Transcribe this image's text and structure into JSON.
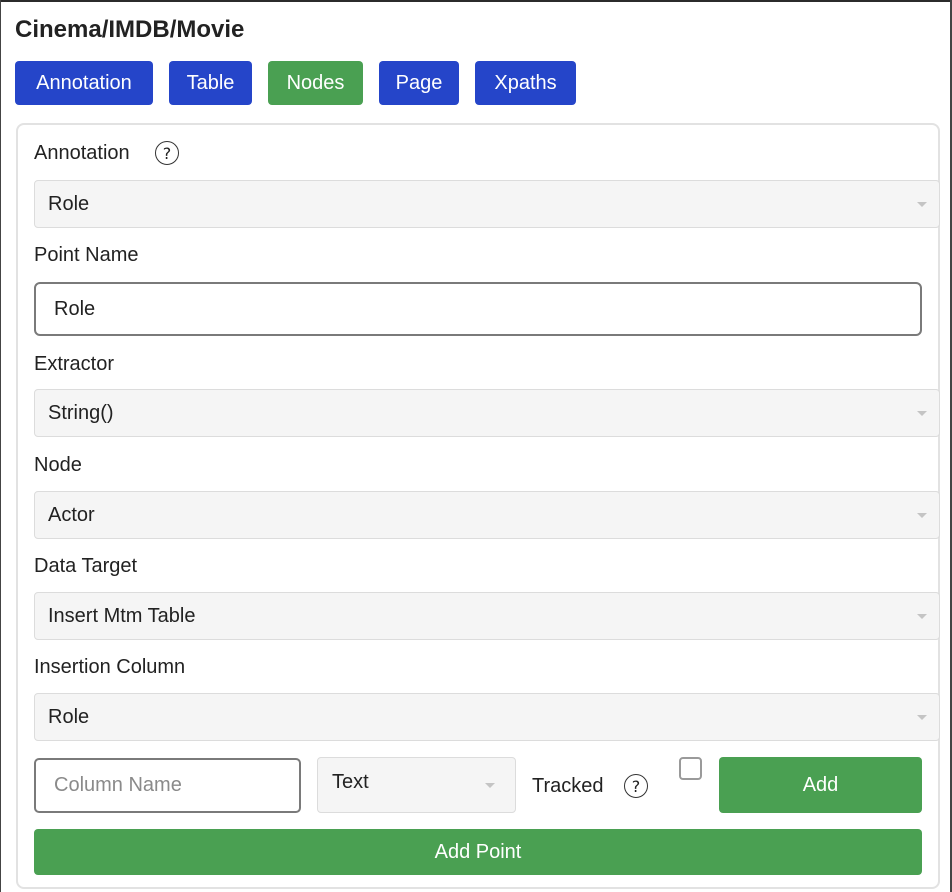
{
  "header": {
    "title": "Cinema/IMDB/Movie"
  },
  "nav": {
    "annotation": "Annotation",
    "table": "Table",
    "nodes": "Nodes",
    "page": "Page",
    "xpaths": "Xpaths"
  },
  "form": {
    "annotation": {
      "label": "Annotation",
      "help": "?",
      "value": "Role"
    },
    "point_name": {
      "label": "Point Name",
      "value": "Role"
    },
    "extractor": {
      "label": "Extractor",
      "value": "String()"
    },
    "node": {
      "label": "Node",
      "value": "Actor"
    },
    "data_target": {
      "label": "Data Target",
      "value": "Insert Mtm Table"
    },
    "insertion_column": {
      "label": "Insertion Column",
      "value": "Role"
    },
    "column_row": {
      "placeholder": "Column Name",
      "type_value": "Text",
      "tracked_label": "Tracked",
      "tracked_help": "?",
      "tracked_checked": false,
      "add_label": "Add"
    },
    "add_point_label": "Add Point"
  },
  "colors": {
    "primary_blue": "#2545c9",
    "active_green": "#4aa052"
  },
  "icons": [
    "help-icon",
    "dropdown-caret-icon"
  ]
}
